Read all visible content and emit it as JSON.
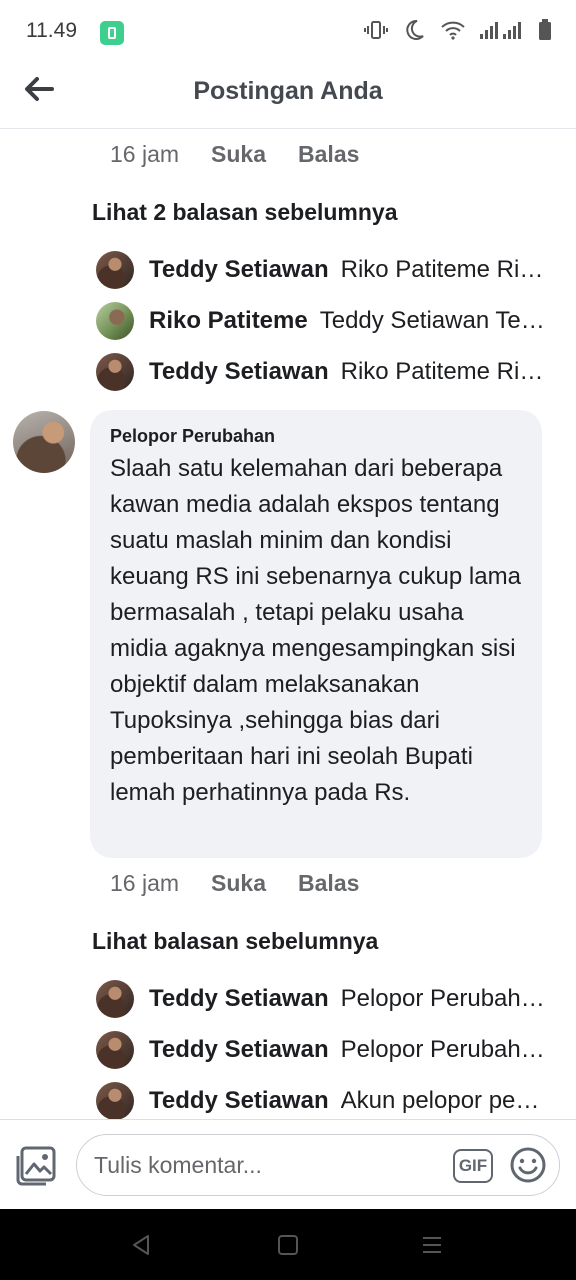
{
  "status_bar": {
    "time": "11.49",
    "icons": [
      "app-notification-icon",
      "vibrate-icon",
      "moon-icon",
      "wifi-icon",
      "signal-icon",
      "battery-icon"
    ]
  },
  "header": {
    "title": "Postingan Anda",
    "back_icon": "arrow-left-icon"
  },
  "thread_top": {
    "meta": {
      "time": "16 jam",
      "like": "Suka",
      "reply": "Balas"
    },
    "prev_link": "Lihat 2 balasan sebelumnya",
    "replies": [
      {
        "name": "Teddy Setiawan",
        "snippet": "Riko Patiteme Riko Patiteme",
        "avatar": "teddy"
      },
      {
        "name": "Riko Patiteme",
        "snippet": "Teddy Setiawan Teddy Setiawan",
        "avatar": "riko"
      },
      {
        "name": "Teddy Setiawan",
        "snippet": "Riko Patiteme Riko Patiteme",
        "avatar": "teddy"
      }
    ]
  },
  "main_comment": {
    "author": "Pelopor Perubahan",
    "text": "Slaah satu kelemahan dari beberapa kawan media adalah ekspos tentang suatu maslah minim dan kondisi keuang RS ini sebenarnya cukup lama bermasalah , tetapi pelaku usaha midia agaknya mengesampingkan sisi objektif dalam melaksanakan Tupoksinya ,sehingga bias dari pemberitaan hari ini seolah Bupati lemah perhatinnya pada Rs.",
    "meta": {
      "time": "16 jam",
      "like": "Suka",
      "reply": "Balas"
    }
  },
  "thread_bottom": {
    "prev_link": "Lihat balasan sebelumnya",
    "replies": [
      {
        "name": "Teddy Setiawan",
        "snippet": "Pelopor Perubahan Pelopor",
        "avatar": "teddy"
      },
      {
        "name": "Teddy Setiawan",
        "snippet": "Pelopor Perubahan Pelopor",
        "avatar": "teddy"
      },
      {
        "name": "Teddy Setiawan",
        "snippet": "Akun pelopor perubahan ini",
        "avatar": "teddy"
      }
    ]
  },
  "composer": {
    "placeholder": "Tulis komentar...",
    "gif_label": "GIF",
    "icons": [
      "photo-icon",
      "smiley-icon"
    ]
  }
}
